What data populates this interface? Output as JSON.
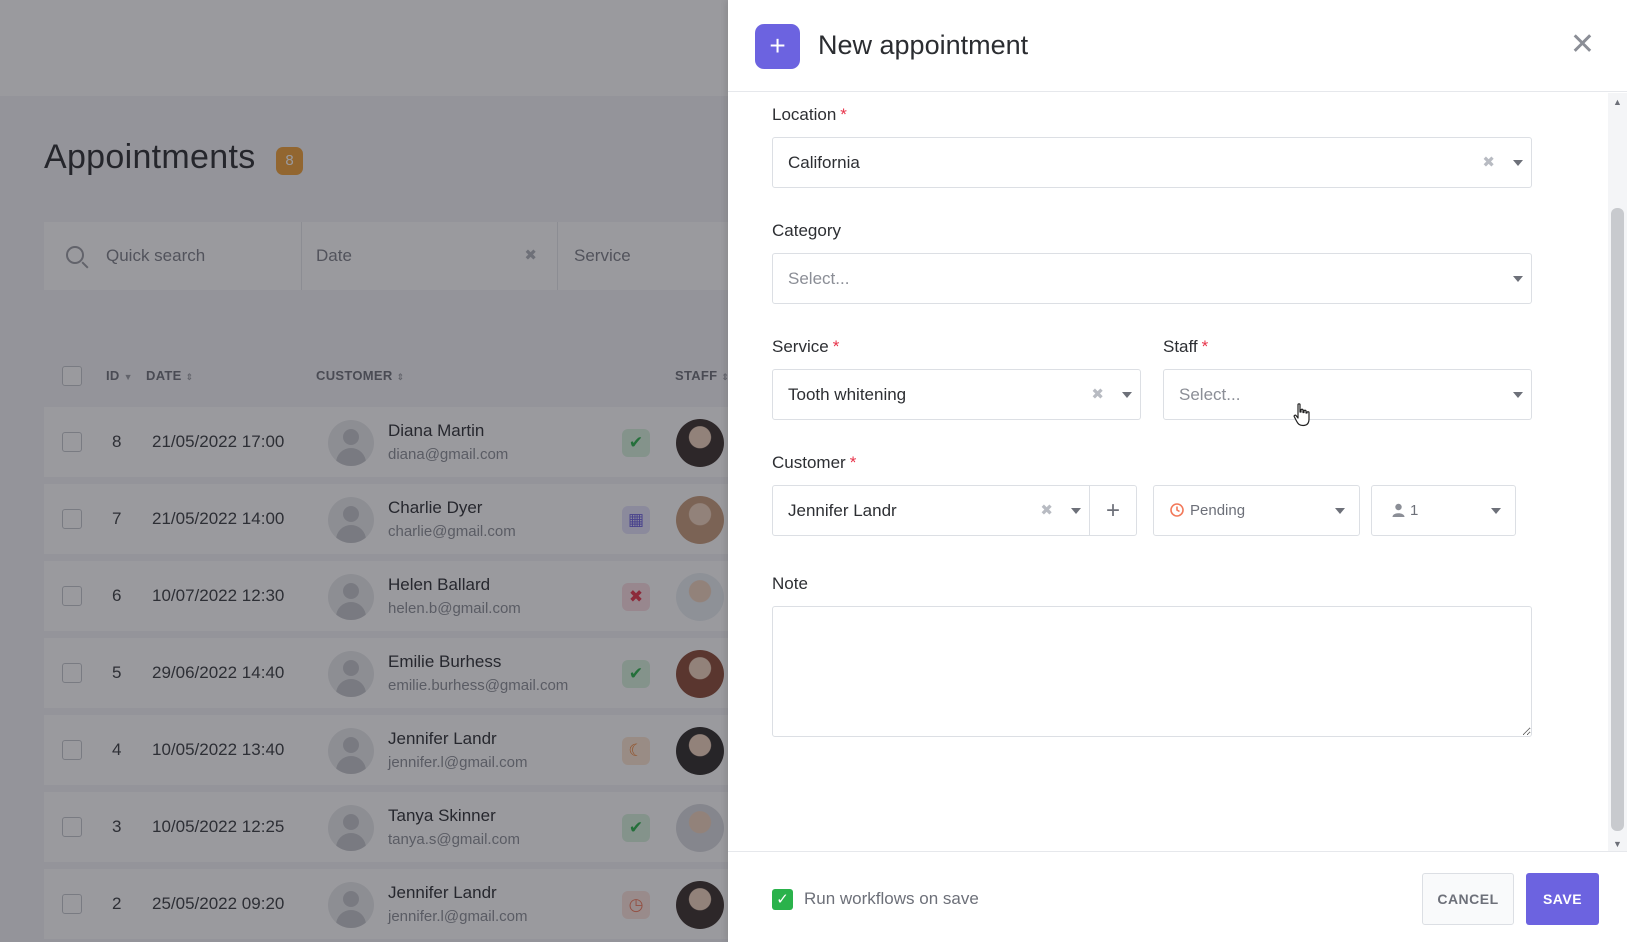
{
  "background": {
    "page_title": "Appointments",
    "count_badge": "8",
    "filters": {
      "search_placeholder": "Quick search",
      "date_placeholder": "Date",
      "service_placeholder": "Service"
    },
    "table": {
      "columns": [
        "ID",
        "DATE",
        "CUSTOMER",
        "STAFF"
      ],
      "rows": [
        {
          "id": "8",
          "date": "21/05/2022 17:00",
          "name": "Diana Martin",
          "email": "diana@gmail.com",
          "status": "approved"
        },
        {
          "id": "7",
          "date": "21/05/2022 14:00",
          "name": "Charlie Dyer",
          "email": "charlie@gmail.com",
          "status": "scheduled"
        },
        {
          "id": "6",
          "date": "10/07/2022 12:30",
          "name": "Helen Ballard",
          "email": "helen.b@gmail.com",
          "status": "rejected"
        },
        {
          "id": "5",
          "date": "29/06/2022 14:40",
          "name": "Emilie Burhess",
          "email": "emilie.burhess@gmail.com",
          "status": "approved"
        },
        {
          "id": "4",
          "date": "10/05/2022 13:40",
          "name": "Jennifer Landr",
          "email": "jennifer.l@gmail.com",
          "status": "no-show"
        },
        {
          "id": "3",
          "date": "10/05/2022 12:25",
          "name": "Tanya Skinner",
          "email": "tanya.s@gmail.com",
          "status": "approved"
        },
        {
          "id": "2",
          "date": "25/05/2022 09:20",
          "name": "Jennifer Landr",
          "email": "jennifer.l@gmail.com",
          "status": "pending"
        }
      ]
    }
  },
  "drawer": {
    "title": "New appointment",
    "header_icon": "plus-icon",
    "close_icon": "close-icon",
    "location": {
      "label": "Location",
      "value": "California"
    },
    "category": {
      "label": "Category",
      "placeholder": "Select..."
    },
    "service": {
      "label": "Service",
      "value": "Tooth whitening"
    },
    "staff": {
      "label": "Staff",
      "placeholder": "Select..."
    },
    "customer": {
      "label": "Customer",
      "value": "Jennifer Landr",
      "add_icon": "plus-icon"
    },
    "status": {
      "value": "Pending",
      "icon": "clock-icon"
    },
    "persons": {
      "value": "1",
      "icon": "user-icon"
    },
    "note": {
      "label": "Note",
      "value": ""
    },
    "footer": {
      "run_workflows_label": "Run workflows on save",
      "run_workflows_checked": true,
      "cancel_label": "CANCEL",
      "save_label": "SAVE"
    }
  },
  "colors": {
    "accent": "#6c63e0",
    "required": "#e8334a",
    "success": "#2ab24b",
    "badge": "#f0a137"
  }
}
